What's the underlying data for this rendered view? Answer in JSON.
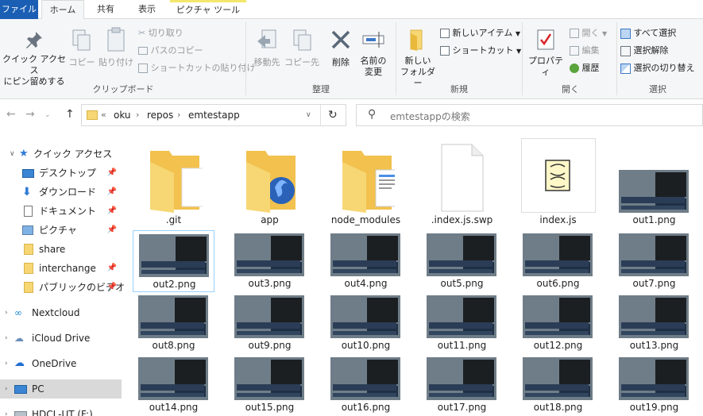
{
  "tabs": [
    "ファイル",
    "ホーム",
    "共有",
    "表示",
    "ピクチャ ツール"
  ],
  "clipboard": {
    "pin_label_1": "クイック アクセス",
    "pin_label_2": "にピン留めする",
    "copy": "コピー",
    "paste": "貼り付け",
    "cut": "切り取り",
    "copy_path": "パスのコピー",
    "paste_shortcut": "ショートカットの貼り付け",
    "group": "クリップボード"
  },
  "organize": {
    "move_to": "移動先",
    "copy_to": "コピー先",
    "delete": "削除",
    "rename_1": "名前の",
    "rename_2": "変更",
    "group": "整理"
  },
  "new": {
    "new_folder_1": "新しい",
    "new_folder_2": "フォルダー",
    "new_item": "新しいアイテム",
    "shortcut": "ショートカット",
    "group": "新規"
  },
  "open": {
    "properties": "プロパティ",
    "open": "開く",
    "edit": "編集",
    "history": "履歴",
    "group": "開く"
  },
  "select": {
    "select_all": "すべて選択",
    "select_none": "選択解除",
    "invert": "選択の切り替え",
    "group": "選択"
  },
  "address": {
    "overflow": "«",
    "crumbs": [
      "oku",
      "repos",
      "emtestapp"
    ],
    "search_placeholder": "emtestappの検索"
  },
  "nav": {
    "quick_access": "クイック アクセス",
    "items": [
      "デスクトップ",
      "ダウンロード",
      "ドキュメント",
      "ピクチャ",
      "share",
      "interchange",
      "パブリックのビデオ"
    ],
    "nextcloud": "Nextcloud",
    "icloud": "iCloud Drive",
    "onedrive": "OneDrive",
    "pc": "PC",
    "drive": "HDCL-UT (F:)"
  },
  "files": [
    ".git",
    "app",
    "node_modules",
    ".index.js.swp",
    "index.js",
    "out1.png",
    "out2.png",
    "out3.png",
    "out4.png",
    "out5.png",
    "out6.png",
    "out7.png",
    "out8.png",
    "out9.png",
    "out10.png",
    "out11.png",
    "out12.png",
    "out13.png",
    "out14.png",
    "out15.png",
    "out16.png",
    "out17.png",
    "out18.png",
    "out19.png"
  ],
  "colors": {
    "accent": "#1a5fb4",
    "folder": "#f7d774",
    "selection": "#cce8ff"
  }
}
